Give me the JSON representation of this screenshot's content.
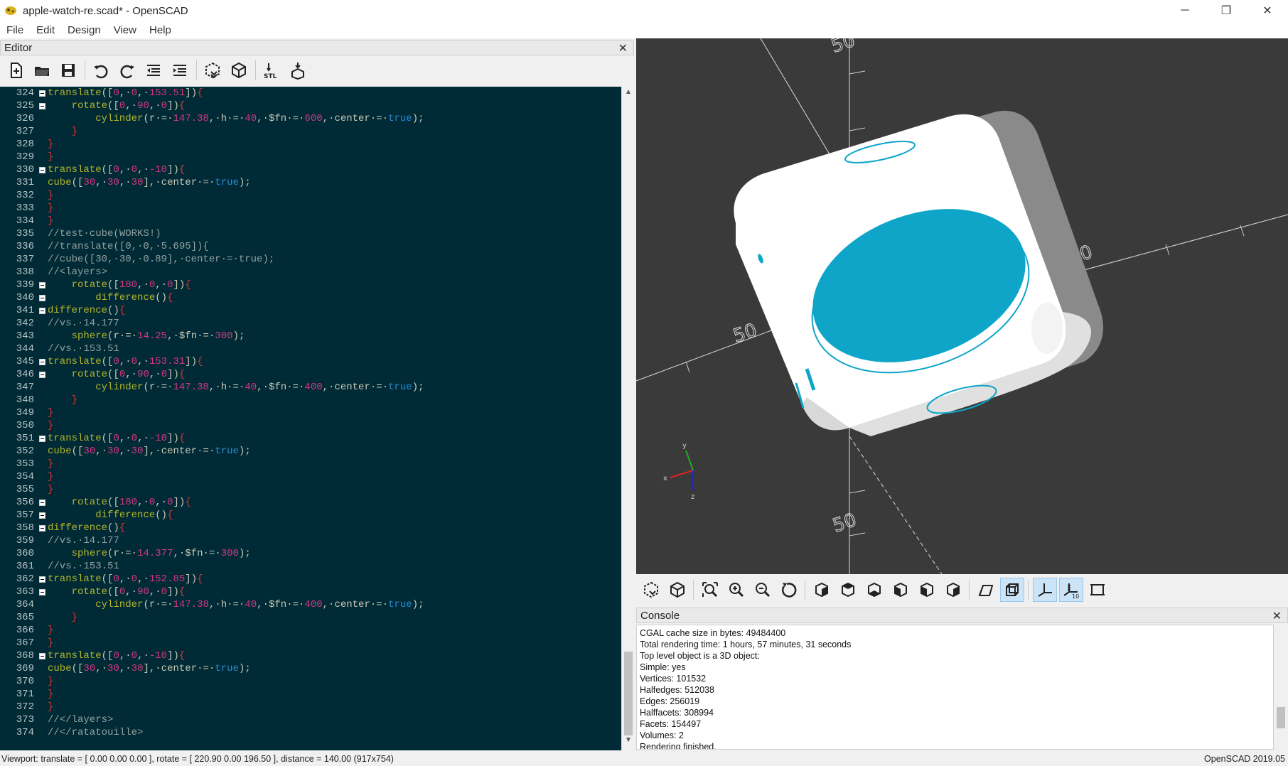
{
  "window": {
    "title": "apple-watch-re.scad* - OpenSCAD",
    "minimize_glyph": "─",
    "restore_glyph": "❐",
    "close_glyph": "✕"
  },
  "menu": [
    "File",
    "Edit",
    "Design",
    "View",
    "Help"
  ],
  "editor": {
    "title": "Editor",
    "close": "✕",
    "toolbar_icons": [
      "new-file-icon",
      "open-file-icon",
      "save-icon",
      "undo-icon",
      "redo-icon",
      "unindent-icon",
      "indent-icon",
      "preview-icon",
      "render-icon",
      "export-stl-icon",
      "send-to-3d-print-icon"
    ],
    "lines": [
      {
        "n": "324",
        "fold": true,
        "t": "translate([0,·0,·153.51]){"
      },
      {
        "n": "325",
        "fold": true,
        "t": "    rotate([0,·90,·0]){"
      },
      {
        "n": "326",
        "fold": false,
        "t": "        cylinder(r·=·147.38,·h·=·40,·$fn·=·600,·center·=·true);"
      },
      {
        "n": "327",
        "fold": false,
        "t": "    }"
      },
      {
        "n": "328",
        "fold": false,
        "t": "}"
      },
      {
        "n": "329",
        "fold": false,
        "t": "}"
      },
      {
        "n": "330",
        "fold": true,
        "t": "translate([0,·0,·-10]){"
      },
      {
        "n": "331",
        "fold": false,
        "t": "cube([30,·30,·30],·center·=·true);"
      },
      {
        "n": "332",
        "fold": false,
        "t": "}"
      },
      {
        "n": "333",
        "fold": false,
        "t": "}"
      },
      {
        "n": "334",
        "fold": false,
        "t": "}"
      },
      {
        "n": "335",
        "fold": false,
        "t": "//test·cube(WORKS!)"
      },
      {
        "n": "336",
        "fold": false,
        "t": "//translate([0,·0,·5.695]){"
      },
      {
        "n": "337",
        "fold": false,
        "t": "//cube([30,·30,·0.89],·center·=·true);"
      },
      {
        "n": "338",
        "fold": false,
        "t": "//<layers>"
      },
      {
        "n": "339",
        "fold": true,
        "t": "    rotate([180,·0,·0]){"
      },
      {
        "n": "340",
        "fold": true,
        "t": "        difference(){"
      },
      {
        "n": "341",
        "fold": true,
        "t": "difference(){"
      },
      {
        "n": "342",
        "fold": false,
        "t": "//vs.·14.177"
      },
      {
        "n": "343",
        "fold": false,
        "t": "    sphere(r·=·14.25,·$fn·=·300);"
      },
      {
        "n": "344",
        "fold": false,
        "t": "//vs.·153.51"
      },
      {
        "n": "345",
        "fold": true,
        "t": "translate([0,·0,·153.31]){"
      },
      {
        "n": "346",
        "fold": true,
        "t": "    rotate([0,·90,·0]){"
      },
      {
        "n": "347",
        "fold": false,
        "t": "        cylinder(r·=·147.38,·h·=·40,·$fn·=·400,·center·=·true);"
      },
      {
        "n": "348",
        "fold": false,
        "t": "    }"
      },
      {
        "n": "349",
        "fold": false,
        "t": "}"
      },
      {
        "n": "350",
        "fold": false,
        "t": "}"
      },
      {
        "n": "351",
        "fold": true,
        "t": "translate([0,·0,·-10]){"
      },
      {
        "n": "352",
        "fold": false,
        "t": "cube([30,·30,·30],·center·=·true);"
      },
      {
        "n": "353",
        "fold": false,
        "t": "}"
      },
      {
        "n": "354",
        "fold": false,
        "t": "}"
      },
      {
        "n": "355",
        "fold": false,
        "t": "}"
      },
      {
        "n": "356",
        "fold": true,
        "t": "    rotate([180,·0,·0]){"
      },
      {
        "n": "357",
        "fold": true,
        "t": "        difference(){"
      },
      {
        "n": "358",
        "fold": true,
        "t": "difference(){"
      },
      {
        "n": "359",
        "fold": false,
        "t": "//vs.·14.177"
      },
      {
        "n": "360",
        "fold": false,
        "t": "    sphere(r·=·14.377,·$fn·=·300);"
      },
      {
        "n": "361",
        "fold": false,
        "t": "//vs.·153.51"
      },
      {
        "n": "362",
        "fold": true,
        "t": "translate([0,·0,·152.85]){"
      },
      {
        "n": "363",
        "fold": true,
        "t": "    rotate([0,·90,·0]){"
      },
      {
        "n": "364",
        "fold": false,
        "t": "        cylinder(r·=·147.38,·h·=·40,·$fn·=·400,·center·=·true);"
      },
      {
        "n": "365",
        "fold": false,
        "t": "    }"
      },
      {
        "n": "366",
        "fold": false,
        "t": "}"
      },
      {
        "n": "367",
        "fold": false,
        "t": "}"
      },
      {
        "n": "368",
        "fold": true,
        "t": "translate([0,·0,·-10]){"
      },
      {
        "n": "369",
        "fold": false,
        "t": "cube([30,·30,·30],·center·=·true);"
      },
      {
        "n": "370",
        "fold": false,
        "t": "}"
      },
      {
        "n": "371",
        "fold": false,
        "t": "}"
      },
      {
        "n": "372",
        "fold": false,
        "t": "}"
      },
      {
        "n": "373",
        "fold": false,
        "t": "//</layers>"
      },
      {
        "n": "374",
        "fold": false,
        "t": "//</ratatouille>"
      }
    ],
    "colors": {
      "keyword": "#b5b52a",
      "number": "#d33682",
      "boolean": "#268bd2",
      "comment": "#93a1a1",
      "text": "#c9c9b6",
      "brace": "#dc322f"
    }
  },
  "viewport": {
    "axis_labels": [
      "50",
      "50",
      "50",
      "50",
      "50"
    ],
    "gizmo": {
      "x": "x",
      "y": "y",
      "z": "z"
    },
    "model_colors": {
      "body": "#ffffff",
      "highlight": "#0ea5c9",
      "background": "#3a3a3a"
    },
    "scale_marker": "10"
  },
  "view_toolbar_icons": [
    "preview-icon",
    "render-icon",
    "view-all-icon",
    "zoom-in-icon",
    "zoom-out-icon",
    "reset-view-icon",
    "view-right-icon",
    "view-top-icon",
    "view-bottom-icon",
    "view-left-icon",
    "view-front-icon",
    "view-back-icon",
    "perspective-icon",
    "orthogonal-icon",
    "show-axes-icon",
    "show-scale-icon",
    "show-edges-icon"
  ],
  "console": {
    "title": "Console",
    "close": "✕",
    "lines": [
      "CGAL cache size in bytes: 49484400",
      "Total rendering time: 1 hours, 57 minutes, 31 seconds",
      "Top level object is a 3D object:",
      "Simple: yes",
      "Vertices: 101532",
      "Halfedges: 512038",
      "Edges: 256019",
      "Halffacets: 308994",
      "Facets: 154497",
      "Volumes: 2",
      "Rendering finished."
    ]
  },
  "status": {
    "viewport": "Viewport: translate = [ 0.00 0.00 0.00 ], rotate = [ 220.90 0.00 196.50 ], distance = 140.00 (917x754)",
    "version": "OpenSCAD 2019.05"
  }
}
